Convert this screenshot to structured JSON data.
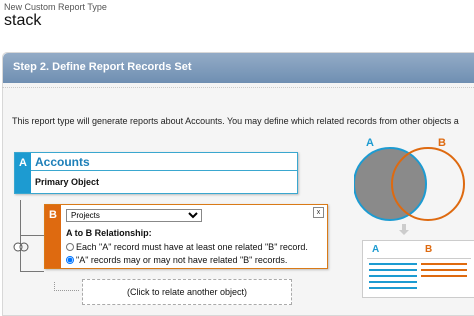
{
  "header": {
    "breadcrumb": "New Custom Report Type",
    "title": "stack"
  },
  "step": {
    "title": "Step 2. Define Report Records Set",
    "description": "This report type will generate reports about Accounts. You may define which related records from other objects a"
  },
  "object_a": {
    "letter": "A",
    "name": "Accounts",
    "subtitle": "Primary Object",
    "color": "#1d9bd1"
  },
  "object_b": {
    "letter": "B",
    "selected": "Projects",
    "close": "x",
    "relationship_label": "A to B Relationship:",
    "options": [
      {
        "label": "Each \"A\" record must have at least one related \"B\" record.",
        "checked": false
      },
      {
        "label": "\"A\" records may or may not have related \"B\" records.",
        "checked": true
      }
    ],
    "color": "#de6a10"
  },
  "relate_another": "(Click to relate another object)",
  "diagram": {
    "venn_a": "A",
    "venn_b": "B",
    "table_a": "A",
    "table_b": "B",
    "icons": [
      "venn-diagram",
      "down-arrow-icon",
      "result-table-icon"
    ]
  }
}
